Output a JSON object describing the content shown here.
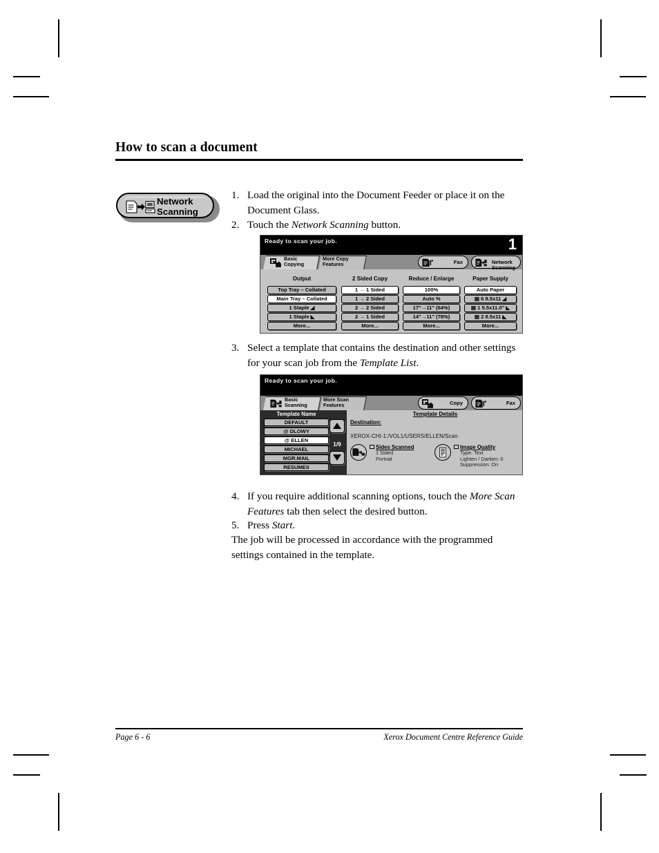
{
  "document": {
    "title": "How to scan a document",
    "footer": {
      "page_label": "Page 6 - 6",
      "guide_title": "Xerox Document Centre Reference Guide"
    }
  },
  "network_scanning_button": {
    "line1": "Network",
    "line2": "Scanning",
    "icon": "document-to-computer-icon"
  },
  "steps": [
    {
      "num": "1.",
      "text": "Load the original into the Document Feeder or place it on the Document Glass."
    },
    {
      "num": "2.",
      "text_before": "Touch the ",
      "emphasis": "Network Scanning",
      "text_after": " button."
    },
    {
      "num": "3.",
      "text_before": "Select a template that contains the destination and other settings for your scan job from the ",
      "emphasis": "Template List",
      "text_after": "."
    },
    {
      "num": "4.",
      "text_before": "If you require additional scanning options, touch the ",
      "emphasis": "More Scan Features",
      "text_after": " tab then select the desired button."
    },
    {
      "num": "5.",
      "text_before": "Press ",
      "emphasis": "Start",
      "text_after": "."
    }
  ],
  "closing_note": "The job will be processed in accordance with the programmed settings contained in the template.",
  "panel_copy": {
    "status_message": "Ready to scan your job.",
    "step_number": "1",
    "tabs": [
      {
        "label": "Basic\nCopying",
        "icon": "copy-icon",
        "active": true
      },
      {
        "label": "More Copy\nFeatures",
        "icon": "",
        "active": false
      }
    ],
    "pills": [
      {
        "label": "Fax",
        "icon": "fax-icon"
      },
      {
        "label": "Network\nScanning",
        "icon": "network-scan-icon"
      }
    ],
    "columns": [
      {
        "heading": "Output",
        "buttons": [
          {
            "label": "Top Tray – Collated",
            "selected": false
          },
          {
            "label": "Main Tray – Collated",
            "selected": true
          },
          {
            "label": "1 Staple ◢",
            "selected": false
          },
          {
            "label": "1 Staple ◣",
            "selected": false
          },
          {
            "label": "More...",
            "selected": false
          }
        ]
      },
      {
        "heading": "2 Sided Copy",
        "buttons": [
          {
            "label": "1 → 1 Sided",
            "selected": true
          },
          {
            "label": "1 → 2 Sided",
            "selected": false
          },
          {
            "label": "2 → 2 Sided",
            "selected": false
          },
          {
            "label": "2 → 1 Sided",
            "selected": false
          },
          {
            "label": "More...",
            "selected": false
          }
        ]
      },
      {
        "heading": "Reduce / Enlarge",
        "buttons": [
          {
            "label": "100%",
            "selected": true
          },
          {
            "label": "Auto %",
            "selected": false
          },
          {
            "label": "17\"→11\" (64%)",
            "selected": false
          },
          {
            "label": "14\"→11\" (78%)",
            "selected": false
          },
          {
            "label": "More...",
            "selected": false
          }
        ]
      },
      {
        "heading": "Paper Supply",
        "buttons": [
          {
            "label": "Auto Paper",
            "selected": true
          },
          {
            "label": "▤ 6  8.5x11 ◢",
            "selected": false
          },
          {
            "label": "▤ 1  5.5x11.0\" ◣",
            "selected": false
          },
          {
            "label": "▤ 2  8.5x11 ◣",
            "selected": false
          },
          {
            "label": "More...",
            "selected": false
          }
        ]
      }
    ]
  },
  "panel_scan": {
    "status_message": "Ready to scan your job.",
    "tabs": [
      {
        "label": "Basic\nScanning",
        "icon": "scan-icon",
        "active": true
      },
      {
        "label": "More Scan\nFeatures",
        "icon": "",
        "active": false
      }
    ],
    "pills": [
      {
        "label": "Copy",
        "icon": "copy-icon"
      },
      {
        "label": "Fax",
        "icon": "fax-icon"
      }
    ],
    "template_list": {
      "heading": "Template Name",
      "page_indicator": "1/9",
      "items": [
        {
          "label": "DEFAULT",
          "selected": false
        },
        {
          "label": "@ DLOWY",
          "selected": false
        },
        {
          "label": "@ ELLEN",
          "selected": true
        },
        {
          "label": "MICHAEL",
          "selected": false
        },
        {
          "label": "MGR.MAIL",
          "selected": false
        },
        {
          "label": "RESUMES",
          "selected": false
        }
      ]
    },
    "details": {
      "title": "Template Details",
      "destination_label": "Destination:",
      "destination_path": "XEROX-CHI-1:/VOL1/USERS/ELLEN/Scan",
      "features": [
        {
          "title": "Sides Scanned",
          "lines": "1 Sided\nPortrait",
          "icon": "sides-scanned-icon"
        },
        {
          "title": "Image Quality",
          "lines": "Type: Text\nLighten / Darken: 0\nSuppression: On",
          "icon": "image-quality-icon"
        }
      ]
    }
  }
}
